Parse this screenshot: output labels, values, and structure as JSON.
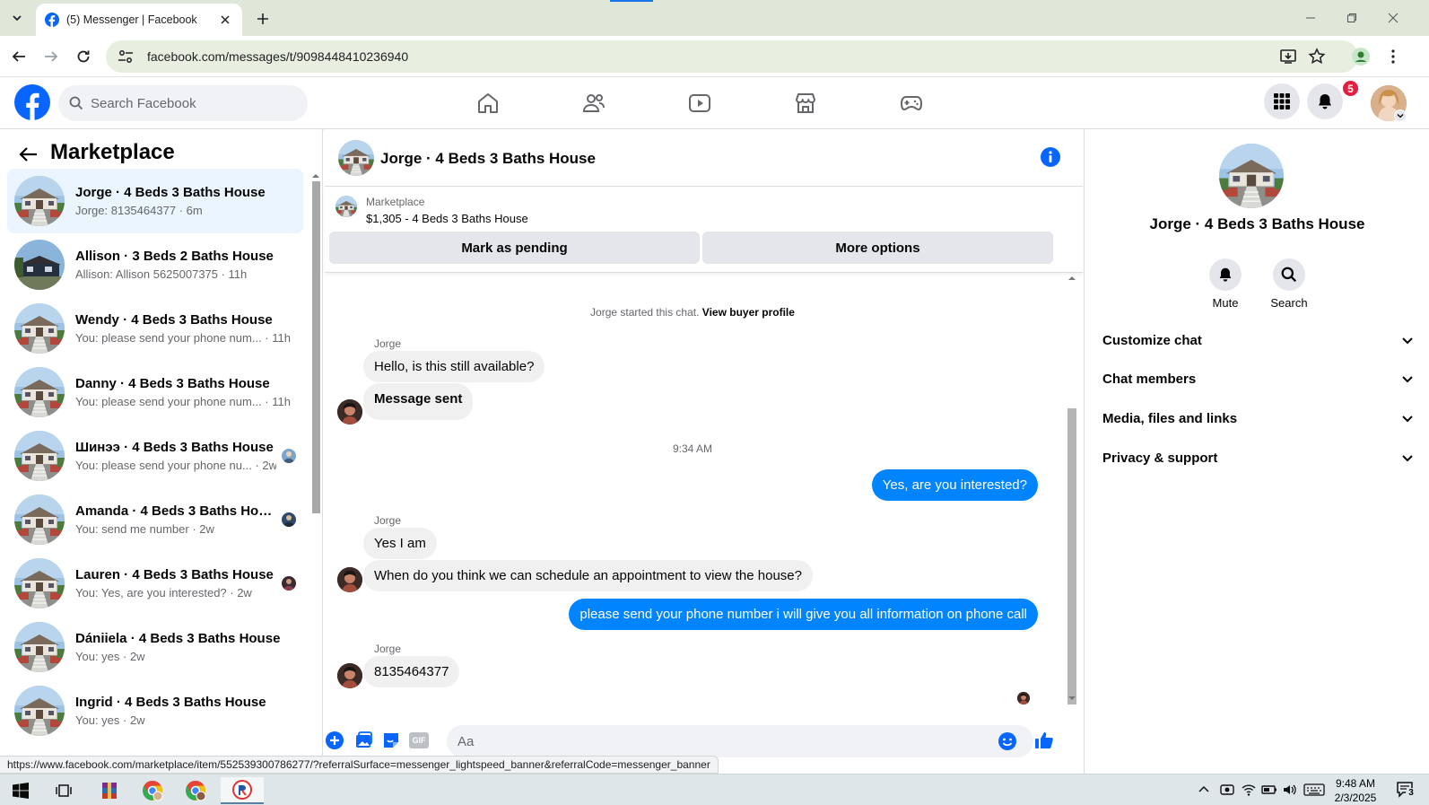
{
  "browser": {
    "tab_title": "(5) Messenger | Facebook",
    "url": "facebook.com/messages/t/9098448410236940",
    "status_url": "https://www.facebook.com/marketplace/item/552539300786277/?referralSurface=messenger_lightspeed_banner&referralCode=messenger_banner"
  },
  "fb": {
    "search_placeholder": "Search Facebook",
    "notification_count": "5",
    "brand_color": "#0866ff"
  },
  "left": {
    "title": "Marketplace",
    "conversations": [
      {
        "name": "Jorge · 4 Beds 3 Baths House",
        "preview": "Jorge: 8135464377 · 6m",
        "active": true
      },
      {
        "name": "Allison · 3 Beds 2 Baths House",
        "preview": "Allison: Allison 5625007375 · 11h"
      },
      {
        "name": "Wendy · 4 Beds 3 Baths House",
        "preview": "You: please send your phone num... · 11h"
      },
      {
        "name": "Danny · 4 Beds 3 Baths House",
        "preview": "You: please send your phone num... · 11h"
      },
      {
        "name": "Шинээ · 4 Beds 3 Baths House",
        "preview": "You: please send your phone nu... · 2w"
      },
      {
        "name": "Amanda · 4 Beds 3 Baths Hou...",
        "preview": "You: send me number · 2w"
      },
      {
        "name": "Lauren · 4 Beds 3 Baths House",
        "preview": "You: Yes, are you interested? · 2w"
      },
      {
        "name": "Dániiela · 4 Beds 3 Baths House",
        "preview": "You: yes · 2w"
      },
      {
        "name": "Ingrid · 4 Beds 3 Baths House",
        "preview": "You: yes · 2w"
      }
    ]
  },
  "chat": {
    "title": "Jorge · 4 Beds 3 Baths House",
    "listing_source": "Marketplace",
    "listing": "$1,305 - 4 Beds 3 Baths House",
    "mark_pending": "Mark as pending",
    "more_options": "More options",
    "started": "Jorge started this chat.",
    "view_profile": "View buyer profile",
    "sender": "Jorge",
    "messages": {
      "m1": "Hello, is this still available?",
      "m2": "Message sent",
      "time": "9:34 AM",
      "m3": "Yes, are you interested?",
      "m4": "Yes I am",
      "m5": "When do you think we can schedule an appointment to view the house?",
      "m6": "please send your phone number i will give you all information on phone call",
      "m7": "8135464377"
    },
    "composer_placeholder": "Aa",
    "gif_label": "GIF",
    "bubble_out_color": "#0084ff"
  },
  "right": {
    "name": "Jorge · 4 Beds 3 Baths House",
    "mute": "Mute",
    "search": "Search",
    "sections": [
      "Customize chat",
      "Chat members",
      "Media, files and links",
      "Privacy & support"
    ]
  },
  "taskbar": {
    "time": "9:48 AM",
    "date": "2/3/2025",
    "notifications": "3"
  }
}
